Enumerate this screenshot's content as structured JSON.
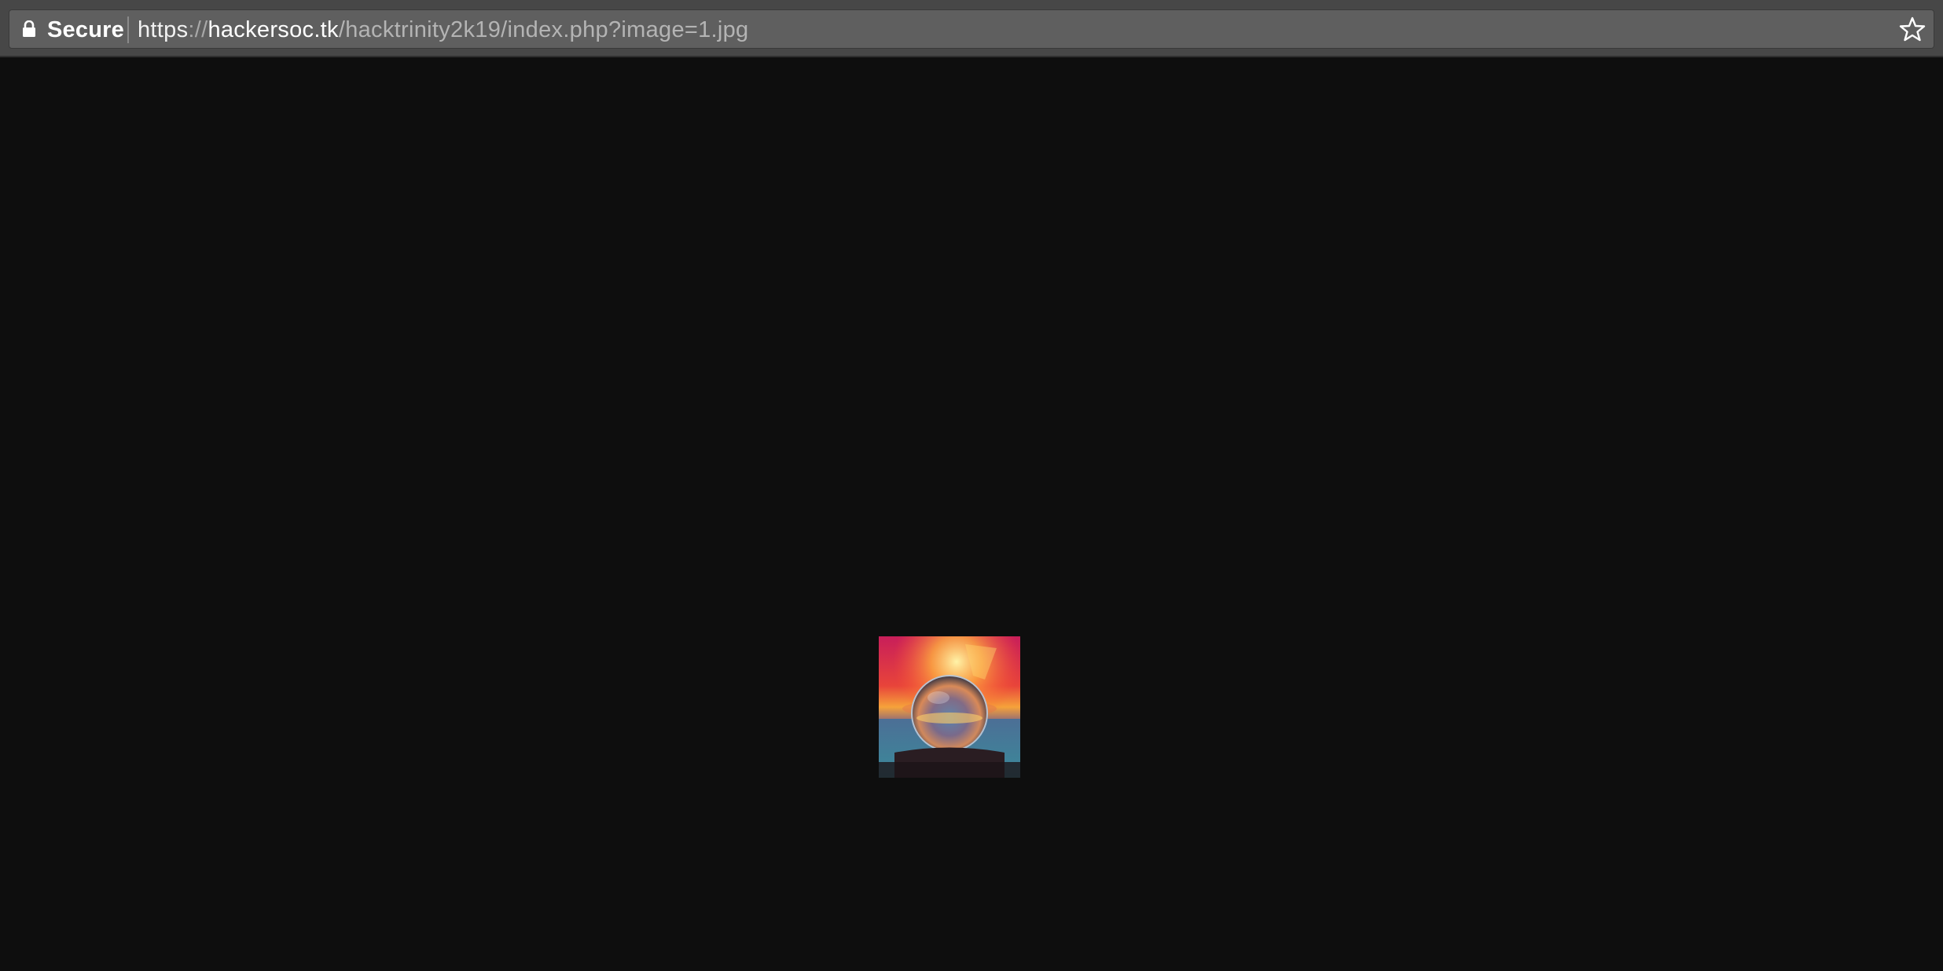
{
  "omnibox": {
    "security_label": "Secure",
    "url_scheme": "https",
    "url_separator": "://",
    "url_host": "hackersoc.tk",
    "url_path": "/hacktrinity2k19/index.php?image=1.jpg",
    "lock_icon": "lock-icon",
    "star_icon": "bookmark-star-icon"
  },
  "page": {
    "background_color": "#0e0e0e",
    "image_description_icon": "image-crystal-ball-sunset"
  }
}
